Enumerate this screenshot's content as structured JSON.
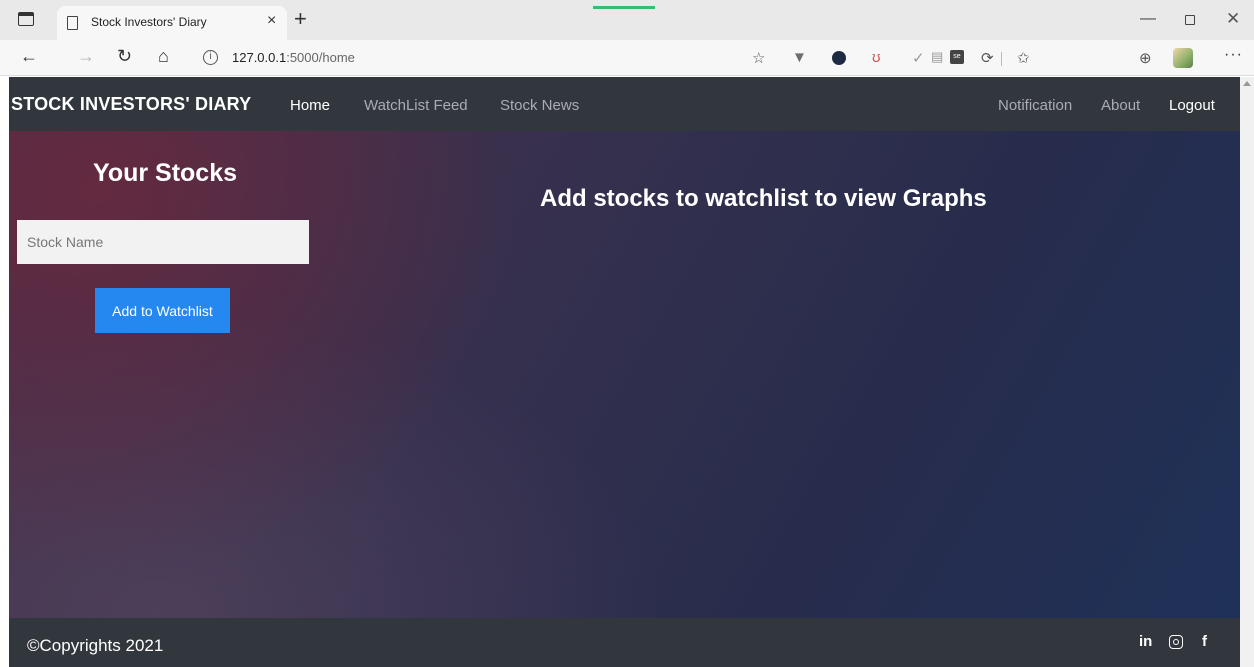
{
  "browser": {
    "tab_title": "Stock Investors' Diary",
    "tab_close": "×",
    "new_tab": "+",
    "url_host": "127.0.0.1",
    "url_path": ":5000/home",
    "info_glyph": "i",
    "ext_box_label": "se",
    "more_label": "···"
  },
  "navbar": {
    "brand": "STOCK INVESTORS' DIARY",
    "links": [
      "Home",
      "WatchList Feed",
      "Stock News",
      "Notification",
      "About",
      "Logout"
    ]
  },
  "sidebar": {
    "title": "Your Stocks",
    "input_placeholder": "Stock Name",
    "button_label": "Add to Watchlist"
  },
  "main": {
    "message": "Add stocks to watchlist to view Graphs"
  },
  "footer": {
    "copyright": "©Copyrights 2021",
    "social": {
      "linkedin": "in",
      "facebook": "f"
    }
  }
}
